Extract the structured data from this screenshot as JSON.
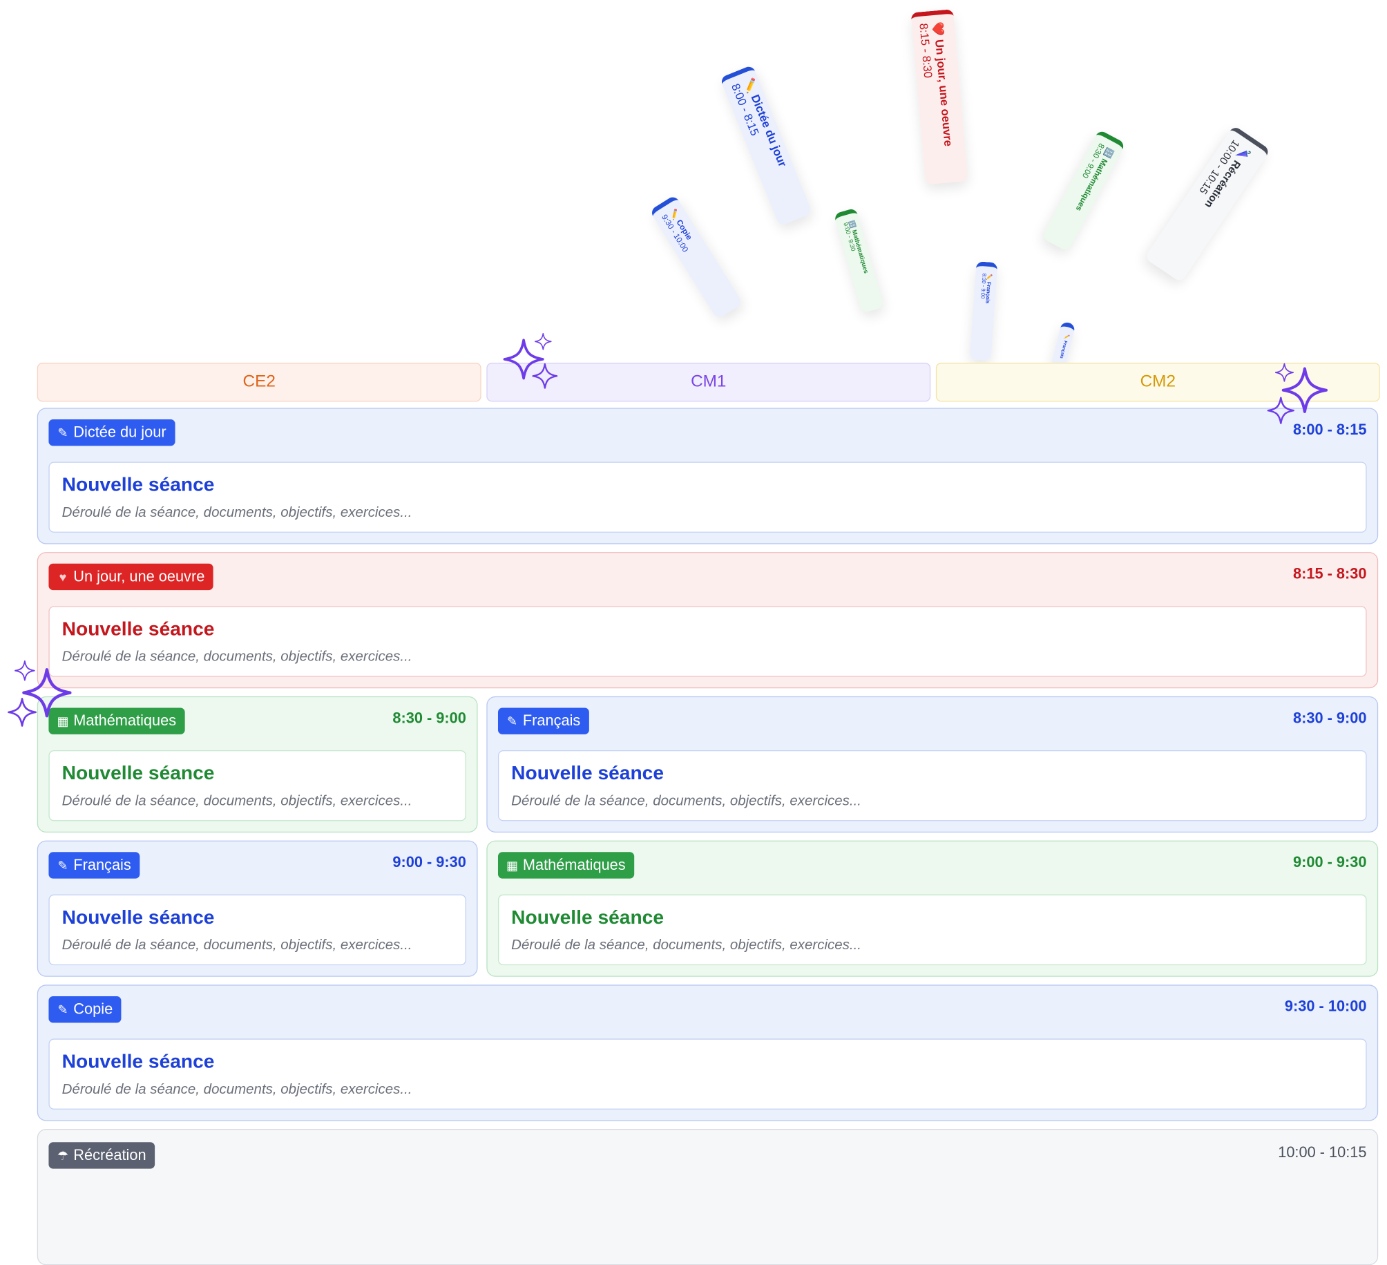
{
  "floating_cards": [
    {
      "icon": "✏️",
      "title": "Dictée du jour",
      "time": "8:00 - 8:15",
      "color": "blue"
    },
    {
      "icon": "❤️",
      "title": "Un jour, une oeuvre",
      "time": "8:15 - 8:30",
      "color": "red"
    },
    {
      "icon": "🔢",
      "title": "Mathématiques",
      "time": "8:30 - 9:00",
      "color": "green"
    },
    {
      "icon": "✏️",
      "title": "Copie",
      "time": "9:30 - 10:00",
      "color": "blue"
    },
    {
      "icon": "🔢",
      "title": "Mathématiques",
      "time": "9:00 - 9:30",
      "color": "green"
    },
    {
      "icon": "✏️",
      "title": "Français",
      "time": "8:30 - 9:00",
      "color": "blue"
    },
    {
      "icon": "🌂",
      "title": "Récréation",
      "time": "10:00 - 10:15",
      "color": "gray"
    },
    {
      "icon": "✏️",
      "title": "Français",
      "time": "",
      "color": "blue"
    }
  ],
  "classes": [
    "CE2",
    "CM1",
    "CM2"
  ],
  "class_colors": {
    "CE2": "#e0641a",
    "CM1": "#7a46e6",
    "CM2": "#d49a06"
  },
  "sessions": [
    {
      "tag": "Dictée du jour",
      "icon": "pencil-icon",
      "time": "8:00 - 8:15",
      "title": "Nouvelle séance",
      "desc": "Déroulé de la séance, documents, objectifs, exercices..."
    },
    {
      "tag": "Un jour, une oeuvre",
      "icon": "heart-icon",
      "time": "8:15 - 8:30",
      "title": "Nouvelle séance",
      "desc": "Déroulé de la séance, documents, objectifs, exercices..."
    },
    {
      "tag": "Mathématiques",
      "icon": "numbers-icon",
      "time": "8:30 - 9:00",
      "title": "Nouvelle séance",
      "desc": "Déroulé de la séance, documents, objectifs, exercices..."
    },
    {
      "tag": "Français",
      "icon": "pencil-icon",
      "time": "8:30 - 9:00",
      "title": "Nouvelle séance",
      "desc": "Déroulé de la séance, documents, objectifs, exercices..."
    },
    {
      "tag": "Français",
      "icon": "pencil-icon",
      "time": "9:00 - 9:30",
      "title": "Nouvelle séance",
      "desc": "Déroulé de la séance, documents, objectifs, exercices..."
    },
    {
      "tag": "Mathématiques",
      "icon": "numbers-icon",
      "time": "9:00 - 9:30",
      "title": "Nouvelle séance",
      "desc": "Déroulé de la séance, documents, objectifs, exercices..."
    },
    {
      "tag": "Copie",
      "icon": "pencil-icon",
      "time": "9:30 - 10:00",
      "title": "Nouvelle séance",
      "desc": "Déroulé de la séance, documents, objectifs, exercices..."
    },
    {
      "tag": "Récréation",
      "icon": "umbrella-icon",
      "time": "10:00 - 10:15"
    }
  ],
  "sparkle_color": "#6d3ce8"
}
